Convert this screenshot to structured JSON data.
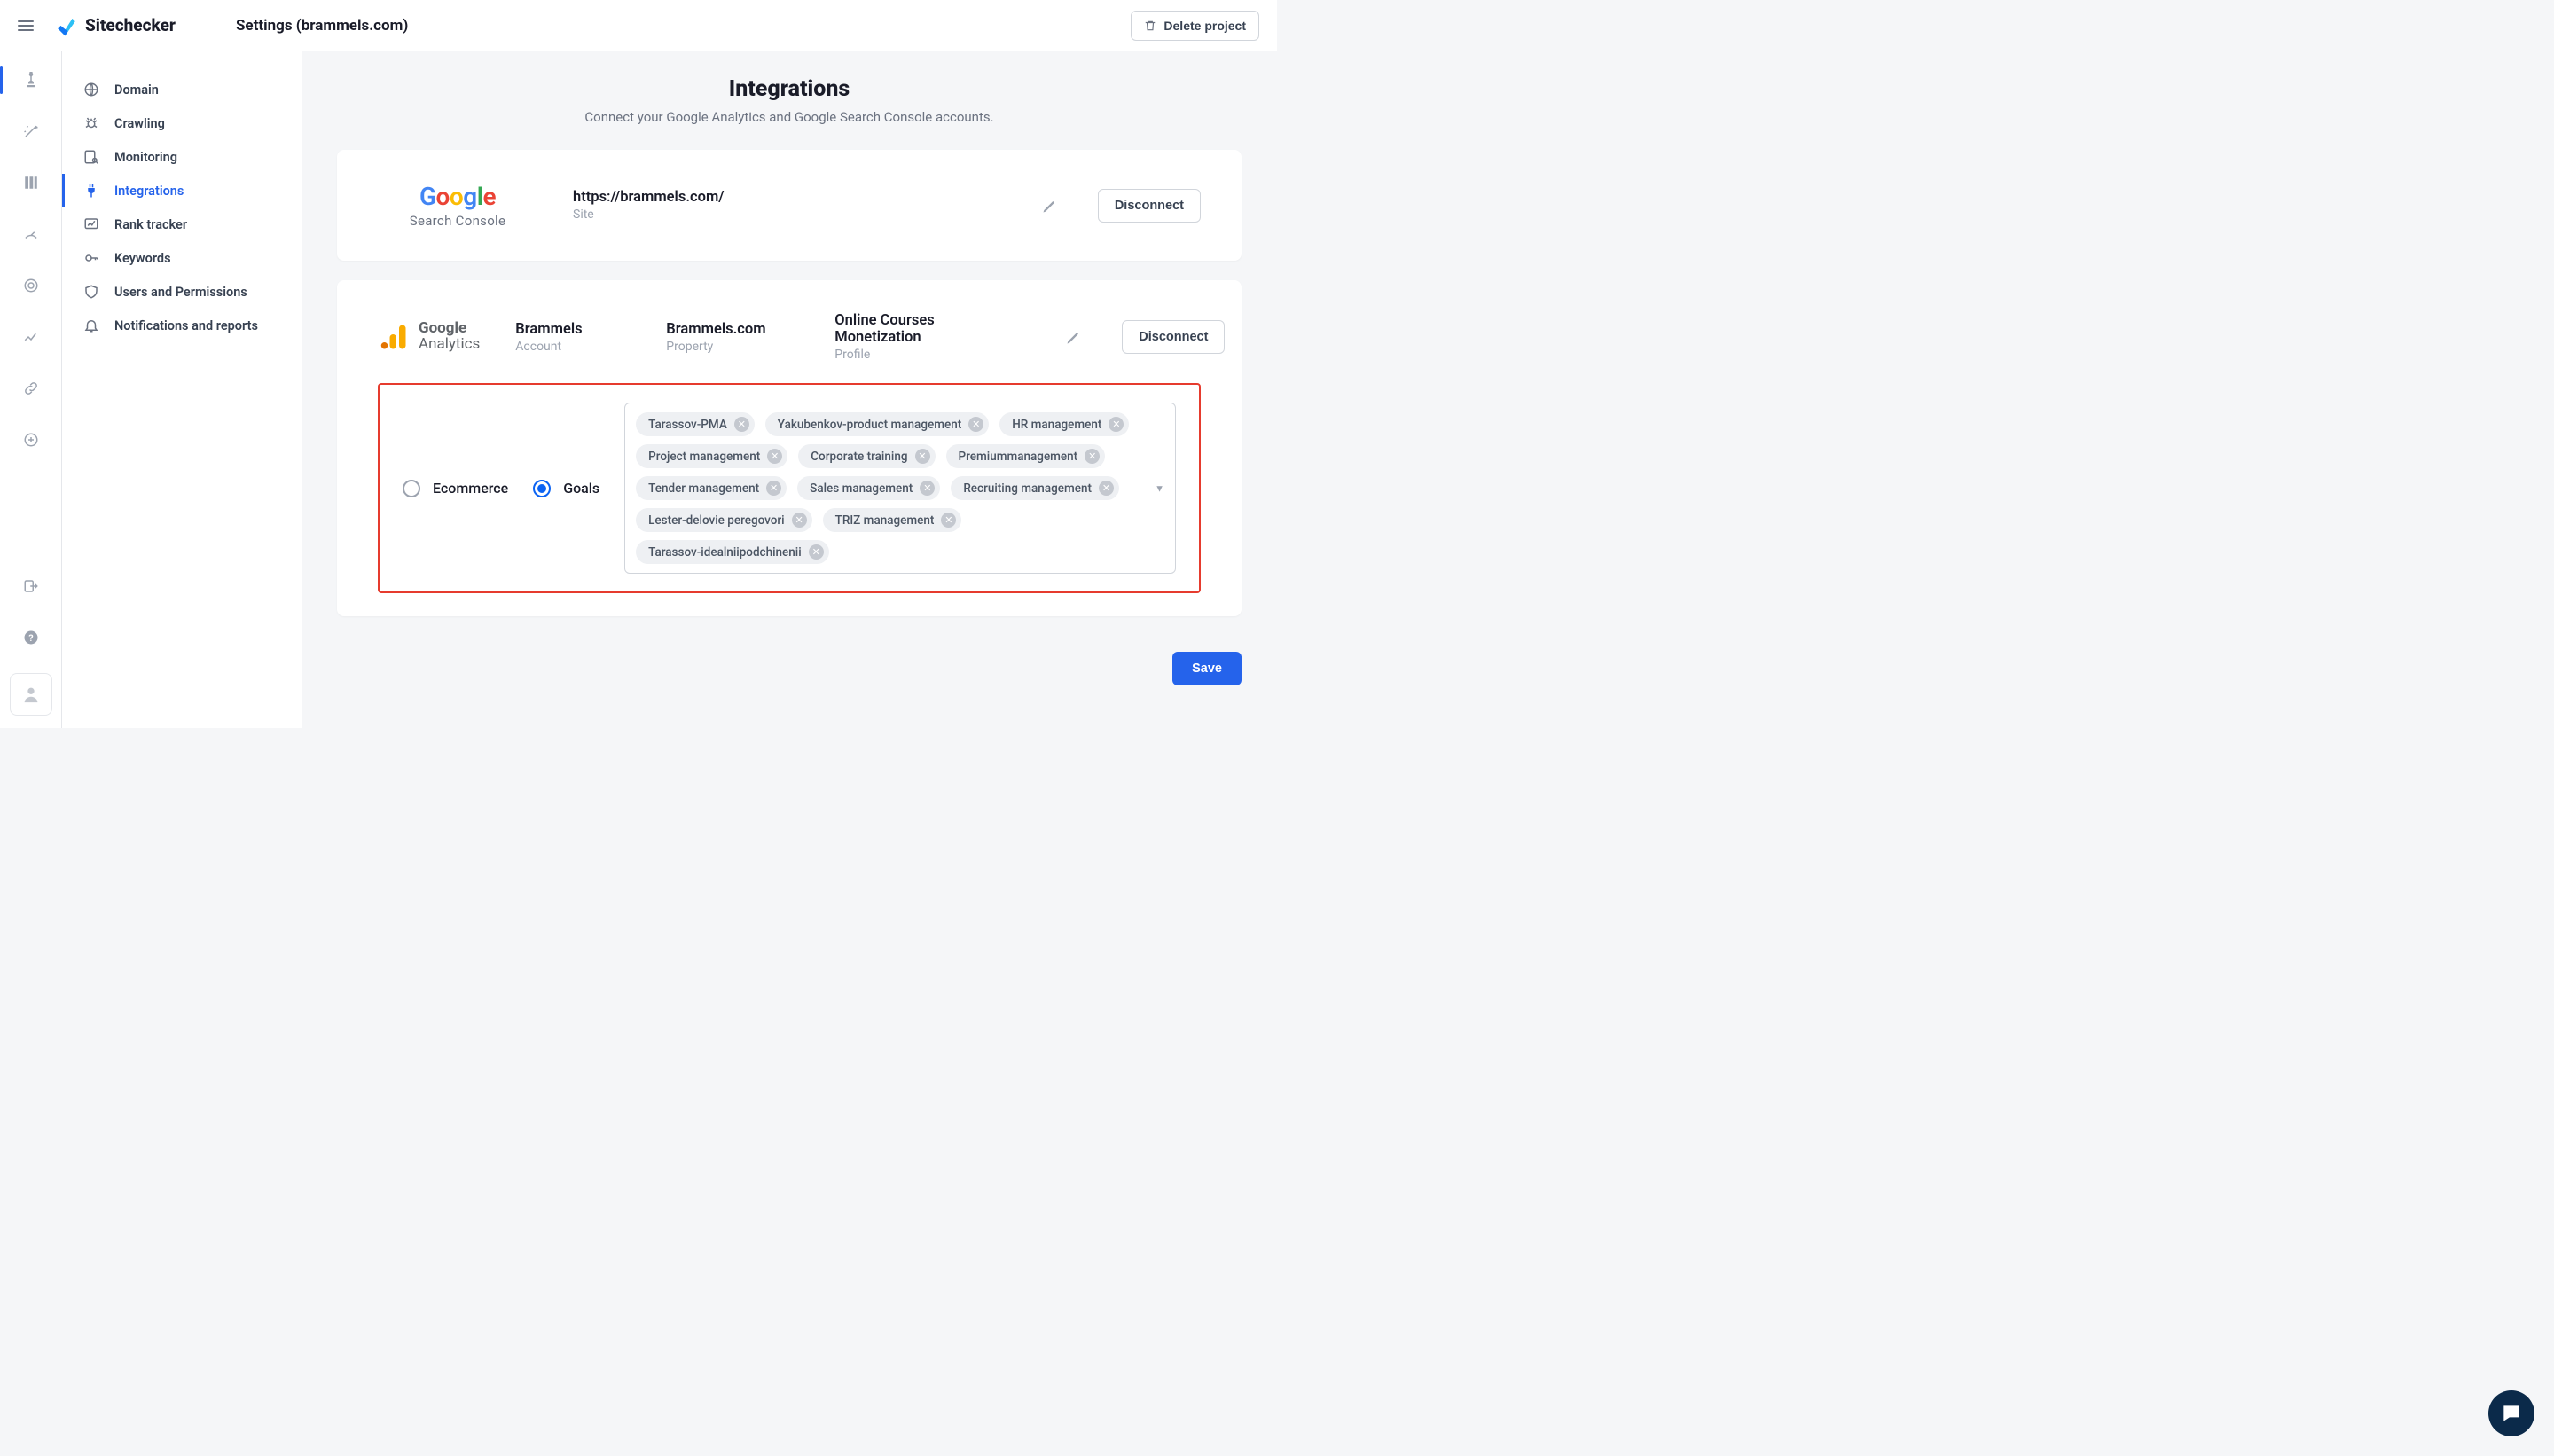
{
  "topbar": {
    "brand": "Sitechecker",
    "page_title": "Settings (brammels.com)",
    "delete_label": "Delete project"
  },
  "nav": {
    "items": [
      {
        "label": "Domain",
        "icon": "globe"
      },
      {
        "label": "Crawling",
        "icon": "bug"
      },
      {
        "label": "Monitoring",
        "icon": "search-page"
      },
      {
        "label": "Integrations",
        "icon": "plug",
        "active": true
      },
      {
        "label": "Rank tracker",
        "icon": "rank"
      },
      {
        "label": "Keywords",
        "icon": "key"
      },
      {
        "label": "Users and Permissions",
        "icon": "shield"
      },
      {
        "label": "Notifications and reports",
        "icon": "bell"
      }
    ]
  },
  "integrations": {
    "heading": "Integrations",
    "subtitle": "Connect your Google Analytics and Google Search Console accounts.",
    "disconnect_label": "Disconnect",
    "save_label": "Save"
  },
  "gsc": {
    "brand_sub": "Search Console",
    "site_value": "https://brammels.com/",
    "site_label": "Site"
  },
  "ga": {
    "brand_top": "Google",
    "brand_bottom": "Analytics",
    "account_value": "Brammels",
    "account_label": "Account",
    "property_value": "Brammels.com",
    "property_label": "Property",
    "profile_value": "Online Courses Monetization",
    "profile_label": "Profile",
    "radio_ecommerce": "Ecommerce",
    "radio_goals": "Goals",
    "goals": [
      "Tarassov-PMA",
      "Yakubenkov-product management",
      "HR management",
      "Project management",
      "Corporate training",
      "Premiummanagement",
      "Tender management",
      "Sales management",
      "Recruiting management",
      "Lester-delovie peregovori",
      "TRIZ management",
      "Tarassov-idealniipodchinenii"
    ]
  }
}
